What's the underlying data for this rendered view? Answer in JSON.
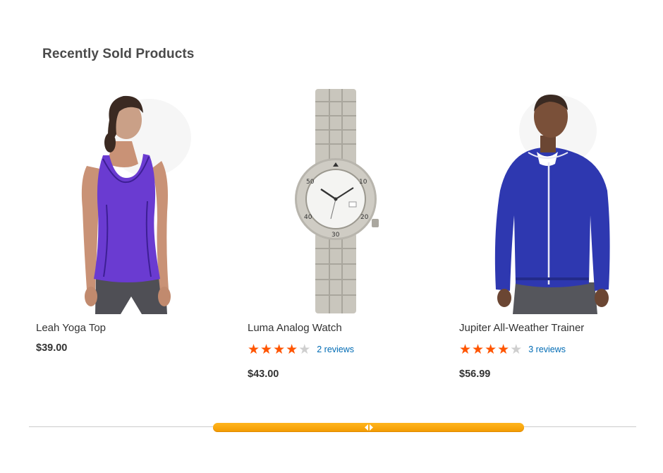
{
  "section": {
    "title": "Recently Sold Products"
  },
  "products": [
    {
      "name": "Leah Yoga Top",
      "price": "$39.00",
      "image_icon": "leah-yoga-top-image"
    },
    {
      "name": "Luma Analog Watch",
      "price": "$43.00",
      "rating": 4,
      "rating_max": 5,
      "reviews": "2 reviews",
      "image_icon": "luma-analog-watch-image"
    },
    {
      "name": "Jupiter All-Weather Trainer",
      "price": "$56.99",
      "rating": 4,
      "rating_max": 5,
      "reviews": "3 reviews",
      "image_icon": "jupiter-all-weather-trainer-image"
    }
  ],
  "watch_face": {
    "bezel_numbers": [
      "50",
      "10",
      "40",
      "20",
      "30"
    ]
  },
  "scrollbar": {
    "position": 0.5,
    "thumb_fraction": 0.51
  },
  "colors": {
    "star_filled": "#ff5501",
    "star_empty": "#cfcfcf",
    "review_link": "#006bb4",
    "scrollbar_thumb": "#f9a912",
    "title_text": "#4a4a4a"
  }
}
